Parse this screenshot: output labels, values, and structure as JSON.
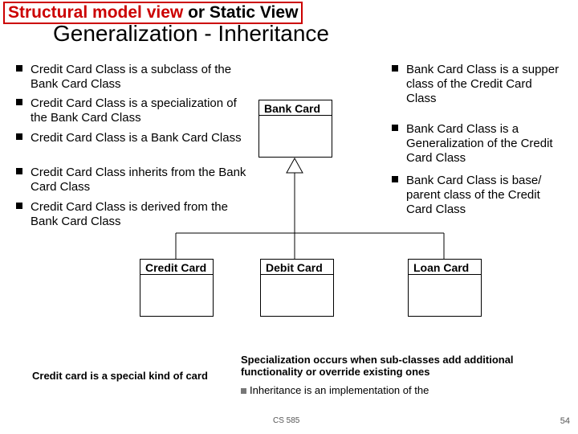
{
  "header": {
    "red_prefix": "Structural model view",
    "black_suffix": " or Static View",
    "title": "Generalization -  Inheritance"
  },
  "left_bullets": [
    "Credit Card Class is a subclass of the Bank Card Class",
    "Credit Card Class is a specialization of the Bank Card Class",
    "Credit Card Class is a Bank Card Class",
    "Credit Card Class inherits from the Bank Card Class",
    "Credit Card Class is derived from the Bank Card Class"
  ],
  "right_bullets": [
    "Bank Card Class is a supper class of the Credit Card Class",
    "Bank Card Class is a Generalization of the Credit Card Class",
    "Bank Card Class is base/ parent class of the  Credit Card Class"
  ],
  "boxes": {
    "bank": "Bank Card",
    "credit": "Credit Card",
    "debit": "Debit Card",
    "loan": "Loan Card"
  },
  "footer_left": "Credit card is a special kind of card",
  "footer_right_bold": "Specialization occurs when sub-classes add additional functionality or override existing ones",
  "footer_right_bullet": "Inheritance is an implementation of the",
  "course": "CS 585",
  "page": "54"
}
